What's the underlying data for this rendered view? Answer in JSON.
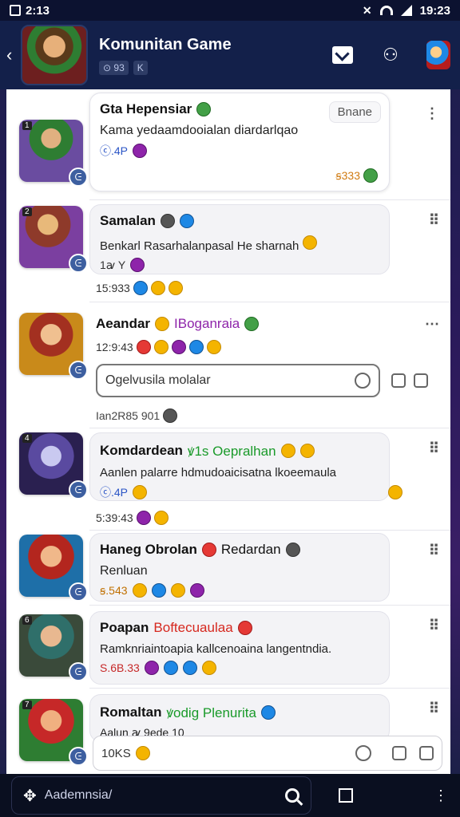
{
  "statusbar": {
    "time_left": "2:13",
    "time_right": "19:23"
  },
  "header": {
    "title": "Komunitan Game",
    "sub_chip_1": "⊙ 93",
    "sub_chip_2": "K"
  },
  "threads": [
    {
      "name": "Gta Hepensiar",
      "tag": "Bnane",
      "message": "Kama yedaamdooialan diardarlqao",
      "meta": "ⓒ.4P",
      "points": "ꞩ333"
    },
    {
      "name": "Samalan",
      "message": "Benkarl Rasarhalanpasal He sharnah",
      "meta": "1ꜹ Y",
      "time": "15:933"
    },
    {
      "name": "Aeandar",
      "name_extra": "IBoganraia",
      "time": "12:9:43",
      "input_placeholder": "Ogelvusila molalar",
      "reply_time": "Ian2R85 901"
    },
    {
      "name": "Komdardean",
      "name_extra": "ꝟ1s Oepralhan",
      "message": "Aanlen palarre hdmudoaicisatna lkoeemaula",
      "meta": "ⓒ.4P",
      "time": "5:39:43"
    },
    {
      "name": "Haneg Obrolan",
      "name_extra": "Redardan",
      "message": "Renluan",
      "time": "ꞩ.543"
    },
    {
      "name": "Poapan",
      "name_extra": "Boftecuaulaa",
      "message": "Ramknriaintoapia kallcenoaina langentndia.",
      "time": "S.6B.33"
    },
    {
      "name": "Romaltan",
      "name_extra": "ꝟodig Plenurita",
      "message": "Aalun ꜹ 9ede 10"
    }
  ],
  "composer": {
    "value": "10KS"
  },
  "bottombar": {
    "search_placeholder": "Aademnsia/"
  },
  "colors": {
    "appbar": "#13204a",
    "accent_blue": "#2b55c6",
    "badge": "#3d5fa0"
  }
}
